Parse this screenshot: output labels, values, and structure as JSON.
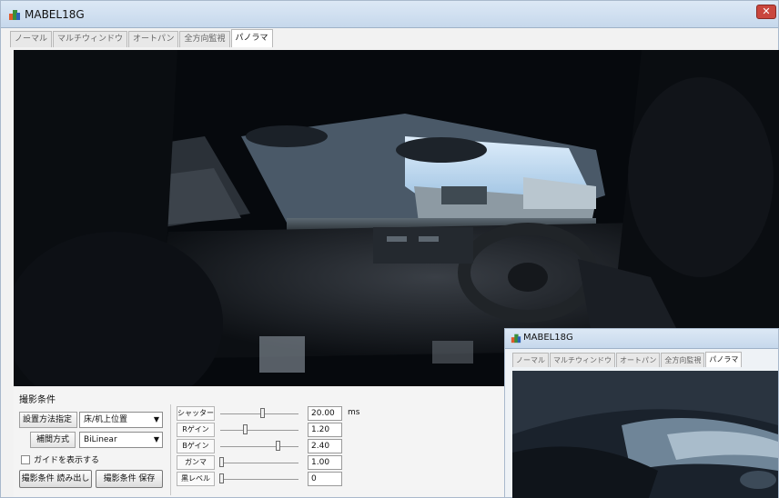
{
  "window": {
    "title": "MABEL18G"
  },
  "tabs": [
    "ノーマル",
    "マルチウィンドウ",
    "オートパン",
    "全方向監視",
    "パノラマ"
  ],
  "active_tab": "パノラマ",
  "panel": {
    "section_title": "撮影条件",
    "install_label": "設置方法指定",
    "install_value": "床/机上位置",
    "interp_label": "補間方式",
    "interp_value": "BiLinear",
    "guide_label": "ガイドを表示する",
    "guide_checked": false,
    "load_button": "撮影条件 読み出し",
    "save_button": "撮影条件 保存"
  },
  "sliders": [
    {
      "label": "シャッター",
      "value": "20.00",
      "unit": "ms",
      "pos": 0.55
    },
    {
      "label": "Rゲイン",
      "value": "1.20",
      "unit": "",
      "pos": 0.33
    },
    {
      "label": "Bゲイン",
      "value": "2.40",
      "unit": "",
      "pos": 0.74
    },
    {
      "label": "ガンマ",
      "value": "1.00",
      "unit": "",
      "pos": 0.02
    },
    {
      "label": "黒レベル",
      "value": "0",
      "unit": "",
      "pos": 0.02
    }
  ],
  "overlay_window": {
    "title": "MABEL18G",
    "tabs": [
      "ノーマル",
      "マルチウィンドウ",
      "オートパン",
      "全方向監視",
      "パノラマ"
    ],
    "active_tab": "パノラマ"
  },
  "colors": {
    "title_gradient_top": "#dce8f5",
    "close": "#c9463d",
    "video_bg": "#070b10"
  }
}
